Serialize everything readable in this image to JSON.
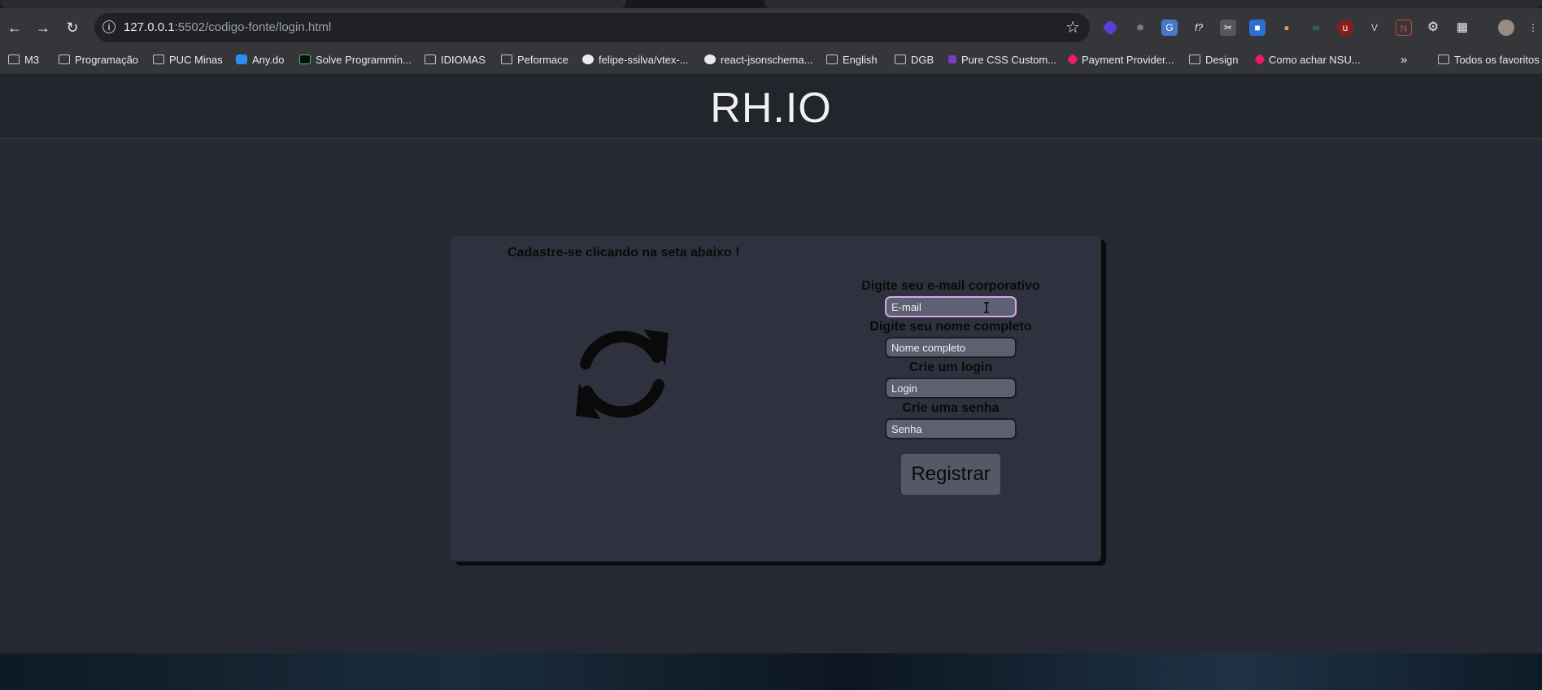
{
  "browser": {
    "url_host": "127.0.0.1",
    "url_path": ":5502/codigo-fonte/login.html",
    "bookmarks": [
      {
        "label": "M3",
        "icon": "folder-icon"
      },
      {
        "label": "Programação",
        "icon": "folder-icon"
      },
      {
        "label": "PUC Minas",
        "icon": "folder-icon"
      },
      {
        "label": "Any.do",
        "icon": "anydo-icon"
      },
      {
        "label": "Solve Programmin...",
        "icon": "hackerrank-icon"
      },
      {
        "label": "IDIOMAS",
        "icon": "folder-icon"
      },
      {
        "label": "Peformace",
        "icon": "folder-icon"
      },
      {
        "label": "felipe-ssilva/vtex-...",
        "icon": "github-icon"
      },
      {
        "label": "react-jsonschema...",
        "icon": "globe-icon"
      },
      {
        "label": "English",
        "icon": "folder-icon"
      },
      {
        "label": "DGB",
        "icon": "folder-icon"
      },
      {
        "label": "Pure CSS Custom...",
        "icon": "codepen-icon"
      },
      {
        "label": "Payment Provider...",
        "icon": "vtex-icon"
      },
      {
        "label": "Design",
        "icon": "folder-icon"
      },
      {
        "label": "Como achar NSU...",
        "icon": "vtex-icon"
      }
    ],
    "overflow_label": "»",
    "all_bookmarks": "Todos os favoritos"
  },
  "page": {
    "title": "RH.IO",
    "hint": "Cadastre-se clicando na seta abaixo !",
    "form": {
      "email_label": "Digite seu e-mail corporativo",
      "email_placeholder": "E-mail",
      "name_label": "Digite seu nome completo",
      "name_placeholder": "Nome completo",
      "login_label": "Crie um login",
      "login_placeholder": "Login",
      "password_label": "Crie uma senha",
      "password_placeholder": "Senha",
      "submit_label": "Registrar"
    }
  },
  "colors": {
    "page_bg": "#262834",
    "header_bg": "#23252d",
    "card_bg": "#2f313f",
    "input_bg": "#5d6070",
    "focus_border": "#d7a6e6"
  }
}
